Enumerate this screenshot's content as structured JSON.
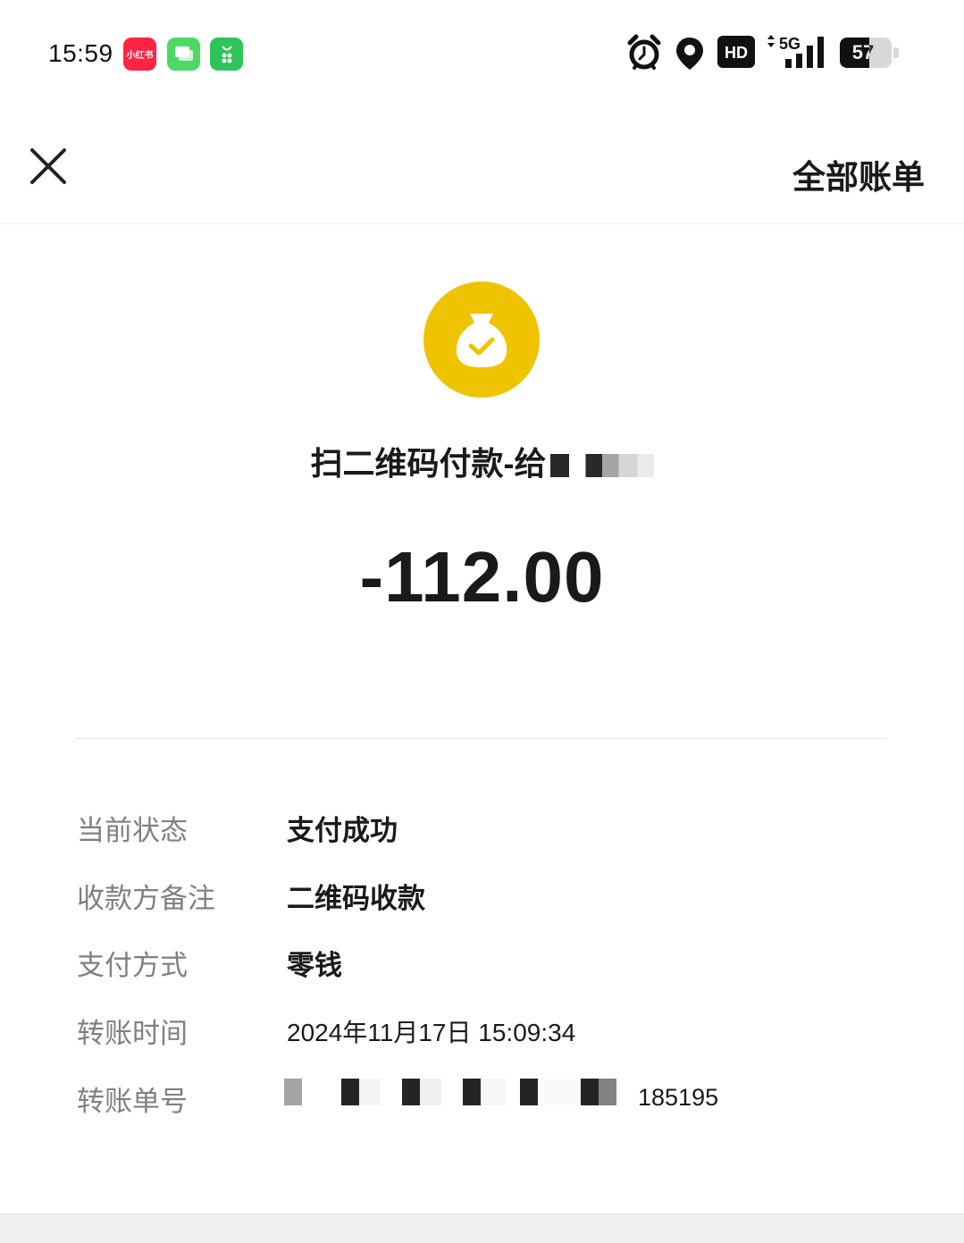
{
  "status_bar": {
    "time": "15:59",
    "apps": [
      {
        "name": "xiaohongshu-icon",
        "label": "小红书",
        "color": "#ff2442"
      },
      {
        "name": "messages-icon",
        "color": "#4cd964"
      },
      {
        "name": "app-store-icon",
        "color": "#2fc45a"
      }
    ],
    "network_label": "5G",
    "hd_label": "HD",
    "battery_level": "57"
  },
  "nav": {
    "close_icon": "close-icon",
    "all_bills_label": "全部账单"
  },
  "summary": {
    "icon": "money-bag-check-icon",
    "icon_color": "#f0c300",
    "title": "扫二维码付款-给",
    "amount": "-112.00"
  },
  "details": {
    "status_label": "当前状态",
    "status_value": "支付成功",
    "note_label": "收款方备注",
    "note_value": "二维码收款",
    "method_label": "支付方式",
    "method_value": "零钱",
    "time_label": "转账时间",
    "time_value": "2024年11月17日 15:09:34",
    "order_label": "转账单号",
    "order_value_visible": "185195"
  }
}
